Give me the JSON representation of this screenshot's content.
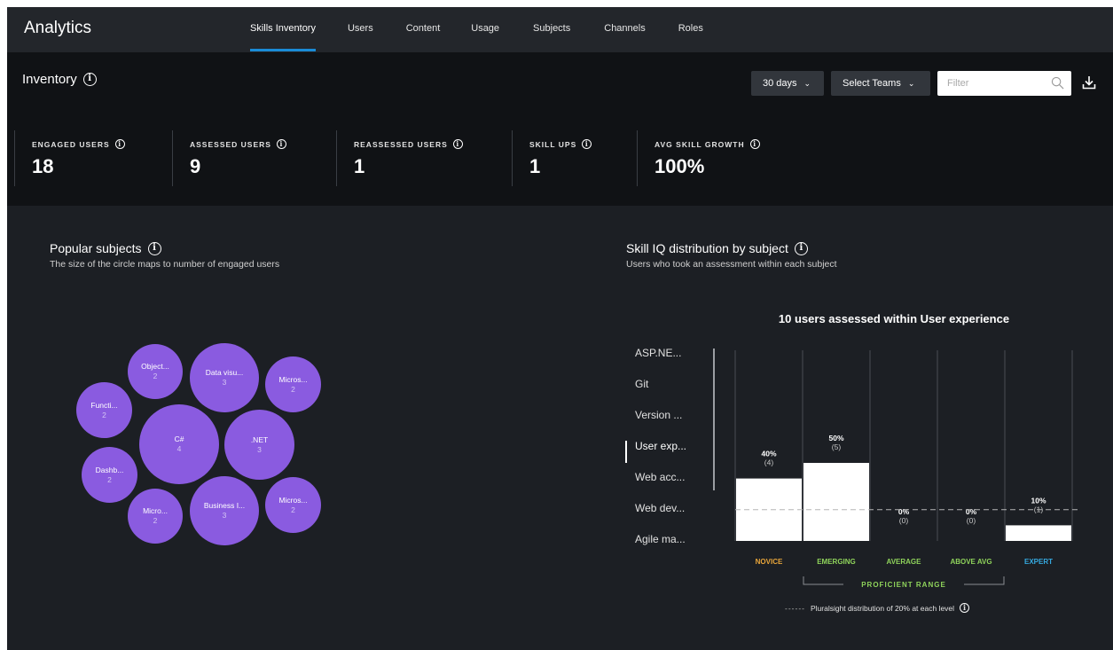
{
  "nav": {
    "brand": "Analytics",
    "tabs": [
      "Skills Inventory",
      "Users",
      "Content",
      "Usage",
      "Subjects",
      "Channels",
      "Roles"
    ]
  },
  "inventory": {
    "title": "Inventory",
    "days_label": "30 days",
    "teams_label": "Select Teams",
    "filter_placeholder": "Filter",
    "stats": [
      {
        "label": "ENGAGED USERS",
        "value": "18"
      },
      {
        "label": "ASSESSED USERS",
        "value": "9"
      },
      {
        "label": "REASSESSED USERS",
        "value": "1"
      },
      {
        "label": "SKILL UPS",
        "value": "1"
      },
      {
        "label": "AVG SKILL GROWTH",
        "value": "100%"
      }
    ]
  },
  "popular": {
    "title": "Popular subjects",
    "subtitle": "The size of the circle maps to number of engaged users",
    "color": "#8a5be0",
    "bubbles": [
      {
        "name": "Object...",
        "count": "2"
      },
      {
        "name": "Data visu...",
        "count": "3"
      },
      {
        "name": "Micros...",
        "count": "2"
      },
      {
        "name": "Functi...",
        "count": "2"
      },
      {
        "name": "C#",
        "count": "4"
      },
      {
        "name": ".NET",
        "count": "3"
      },
      {
        "name": "Dashb...",
        "count": "2"
      },
      {
        "name": "Micro...",
        "count": "2"
      },
      {
        "name": "Business I...",
        "count": "3"
      },
      {
        "name": "Micros...",
        "count": "2"
      }
    ]
  },
  "skilliq": {
    "title": "Skill IQ distribution by subject",
    "subtitle": "Users who took an assessment within each subject",
    "subjects": [
      "ASP.NE...",
      "Git",
      "Version ...",
      "User exp...",
      "Web acc...",
      "Web dev...",
      "Agile ma..."
    ],
    "active_subject": "User exp...",
    "legend": "Pluralsight distribution of 20% at each level"
  },
  "chart_data": {
    "type": "bar",
    "title": "10 users assessed within User experience",
    "categories": [
      "NOVICE",
      "EMERGING",
      "AVERAGE",
      "ABOVE AVG",
      "EXPERT"
    ],
    "values": [
      40,
      50,
      0,
      0,
      10
    ],
    "value_labels": [
      "40%",
      "50%",
      "0%",
      "0%",
      "10%"
    ],
    "counts": [
      "(4)",
      "(5)",
      "(0)",
      "(0)",
      "(1)"
    ],
    "category_colors": [
      "#e8a53a",
      "#8fd35b",
      "#8fd35b",
      "#8fd35b",
      "#35a9e0"
    ],
    "reference_value": 20,
    "range_label": "PROFICIENT RANGE",
    "range_color": "#8fd35b",
    "ylim": [
      0,
      100
    ]
  }
}
